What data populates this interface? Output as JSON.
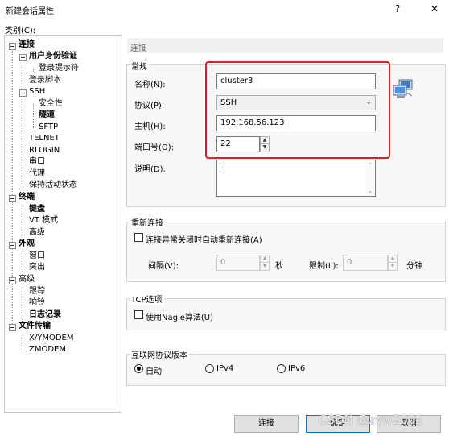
{
  "window": {
    "title": "新建会话属性",
    "help_glyph": "?",
    "close_glyph": "✕"
  },
  "sidebar": {
    "category_label": "类别(C):",
    "items": [
      {
        "label": "连接"
      },
      {
        "label": "用户身份验证"
      },
      {
        "label": "登录提示符"
      },
      {
        "label": "登录脚本"
      },
      {
        "label": "SSH"
      },
      {
        "label": "安全性"
      },
      {
        "label": "隧道"
      },
      {
        "label": "SFTP"
      },
      {
        "label": "TELNET"
      },
      {
        "label": "RLOGIN"
      },
      {
        "label": "串口"
      },
      {
        "label": "代理"
      },
      {
        "label": "保持活动状态"
      },
      {
        "label": "终端"
      },
      {
        "label": "键盘"
      },
      {
        "label": "VT 模式"
      },
      {
        "label": "高级"
      },
      {
        "label": "外观"
      },
      {
        "label": "窗口"
      },
      {
        "label": "突出"
      },
      {
        "label": "高级"
      },
      {
        "label": "跟踪"
      },
      {
        "label": "响铃"
      },
      {
        "label": "日志记录"
      },
      {
        "label": "文件传输"
      },
      {
        "label": "X/YMODEM"
      },
      {
        "label": "ZMODEM"
      }
    ]
  },
  "panel": {
    "header": "连接",
    "general": {
      "title": "常规",
      "name_label": "名称(N):",
      "name_value": "cluster3",
      "protocol_label": "协议(P):",
      "protocol_value": "SSH",
      "host_label": "主机(H):",
      "host_value": "192.168.56.123",
      "port_label": "端口号(O):",
      "port_value": "22",
      "desc_label": "说明(D):",
      "desc_value": ""
    },
    "reconnect": {
      "title": "重新连接",
      "checkbox_label": "连接异常关闭时自动重新连接(A)",
      "interval_label": "间隔(V):",
      "interval_value": "0",
      "interval_unit": "秒",
      "limit_label": "限制(L):",
      "limit_value": "0",
      "limit_unit": "分钟"
    },
    "tcp": {
      "title": "TCP选项",
      "checkbox_label": "使用Nagle算法(U)"
    },
    "ip": {
      "title": "互联网协议版本",
      "options": [
        {
          "label": "自动",
          "selected": true
        },
        {
          "label": "IPv4",
          "selected": false
        },
        {
          "label": "IPv6",
          "selected": false
        }
      ]
    }
  },
  "buttons": {
    "connect": "连接",
    "ok": "确定",
    "cancel": "取消"
  },
  "watermark": "CSDN @zyw2002",
  "colors": {
    "highlight_box": "#e02020",
    "accent": "#0078d7"
  }
}
